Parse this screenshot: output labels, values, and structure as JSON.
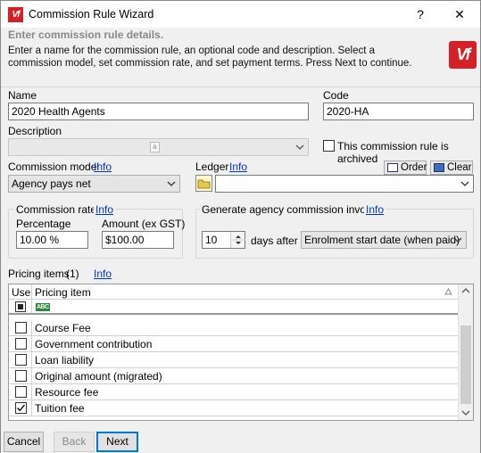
{
  "window": {
    "title": "Commission Rule Wizard",
    "help_label": "?",
    "close_label": "✕",
    "logo_text": "Vf"
  },
  "header": {
    "subtitle": "Enter commission rule details.",
    "description": "Enter a name for the commission rule, an optional code and description. Select a commission model, set commission rate, and set payment terms.  Press Next to continue."
  },
  "form": {
    "name_label": "Name",
    "name_value": "2020 Health Agents",
    "code_label": "Code",
    "code_value": "2020-HA",
    "description_label": "Description",
    "description_value": "",
    "archived_label": "This commission rule is archived",
    "archived_checked": false,
    "model_label": "Commission model",
    "model_info": "Info",
    "model_value": "Agency pays net",
    "ledger_label": "Ledger",
    "ledger_info": "Info",
    "ledger_value": "",
    "order_label": "Order",
    "clear_label": "Clear"
  },
  "commission_rate": {
    "group_label": "Commission rate",
    "info": "Info",
    "percentage_label": "Percentage",
    "percentage_value": "10.00 %",
    "amount_label": "Amount (ex GST)",
    "amount_value": "$100.00"
  },
  "invoice": {
    "group_label": "Generate agency commission invoice",
    "info": "Info",
    "days_value": "10",
    "days_after_label": "days after",
    "trigger_value": "Enrolment start date (when paid)"
  },
  "pricing": {
    "label": "Pricing items",
    "count": "(1)",
    "info": "Info",
    "col_use": "Use",
    "col_item": "Pricing item",
    "filter_icon_text": "ABC",
    "items": [
      {
        "label": "Course Fee",
        "checked": false
      },
      {
        "label": "Government contribution",
        "checked": false
      },
      {
        "label": "Loan liability",
        "checked": false
      },
      {
        "label": "Original amount (migrated)",
        "checked": false
      },
      {
        "label": "Resource fee",
        "checked": false
      },
      {
        "label": "Tuition fee",
        "checked": true
      }
    ]
  },
  "footer": {
    "cancel_label": "Cancel",
    "back_label": "Back",
    "next_label": "Next"
  },
  "colors": {
    "brand": "#d42027",
    "link": "#0033cc",
    "focus": "#0078d7"
  }
}
